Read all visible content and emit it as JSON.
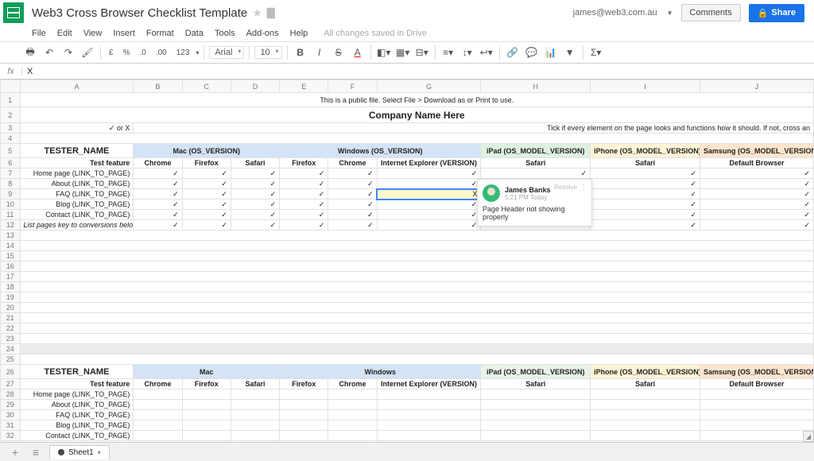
{
  "header": {
    "doc_title": "Web3 Cross Browser Checklist Template",
    "user_email": "james@web3.com.au",
    "comments_btn": "Comments",
    "share_btn": "Share",
    "drive_status": "All changes saved in Drive"
  },
  "menus": [
    "File",
    "Edit",
    "View",
    "Insert",
    "Format",
    "Data",
    "Tools",
    "Add-ons",
    "Help"
  ],
  "toolbar": {
    "font": "Arial",
    "font_size": "10",
    "money": "£",
    "pct": "%",
    "dec_dec": ".0",
    "dec_inc": ".00",
    "onetwothree": "123"
  },
  "formula": {
    "fx": "fx",
    "value": "X"
  },
  "columns": [
    "A",
    "B",
    "C",
    "D",
    "E",
    "F",
    "G",
    "H",
    "I",
    "J"
  ],
  "row1_note": "This is a public file. Select File > Download as or Print to use.",
  "row2_title": "Company Name Here",
  "row3_left": "✓ or X",
  "row3_right": "Tick if every element on the page looks and functions how it should. If not, cross an",
  "tester_header": "TESTER_NAME",
  "platform_row1": {
    "a": "Test feature",
    "b": "Chrome",
    "c": "Firefox",
    "d": "Safari",
    "e": "Firefox",
    "f": "Chrome",
    "g": "Internet Explorer (VERSION)",
    "h": "Safari",
    "i": "Safari",
    "j": "Default Browser"
  },
  "os_row1": {
    "mac": "Mac (OS_VERSION)",
    "win": "Windows (OS_VERSION)",
    "ipad": "iPad (OS_MODEL_VERSION)",
    "iphone": "iPhone (OS_MODEL_VERSION)",
    "samsung": "Samsung (OS_MODEL_VERSION)"
  },
  "pages": [
    "Home page  (LINK_TO_PAGE)",
    "About  (LINK_TO_PAGE)",
    "FAQ  (LINK_TO_PAGE)",
    "Blog  (LINK_TO_PAGE)",
    "Contact  (LINK_TO_PAGE)"
  ],
  "list_pages_note": "List pages key to conversions below",
  "check": "✓",
  "cross": "X",
  "os_row2": {
    "mac": "Mac",
    "win": "Windows",
    "ipad": "iPad (OS_MODEL_VERSION)",
    "iphone": "iPhone (OS_MODEL_VERSION)",
    "samsung": "Samsung (OS_MODEL_VERSION)"
  },
  "comment": {
    "author": "James Banks",
    "time": "5:21 PM Today",
    "resolve": "Resolve",
    "body": "Page Header not showing properly"
  },
  "sheet": {
    "name": "Sheet1"
  }
}
